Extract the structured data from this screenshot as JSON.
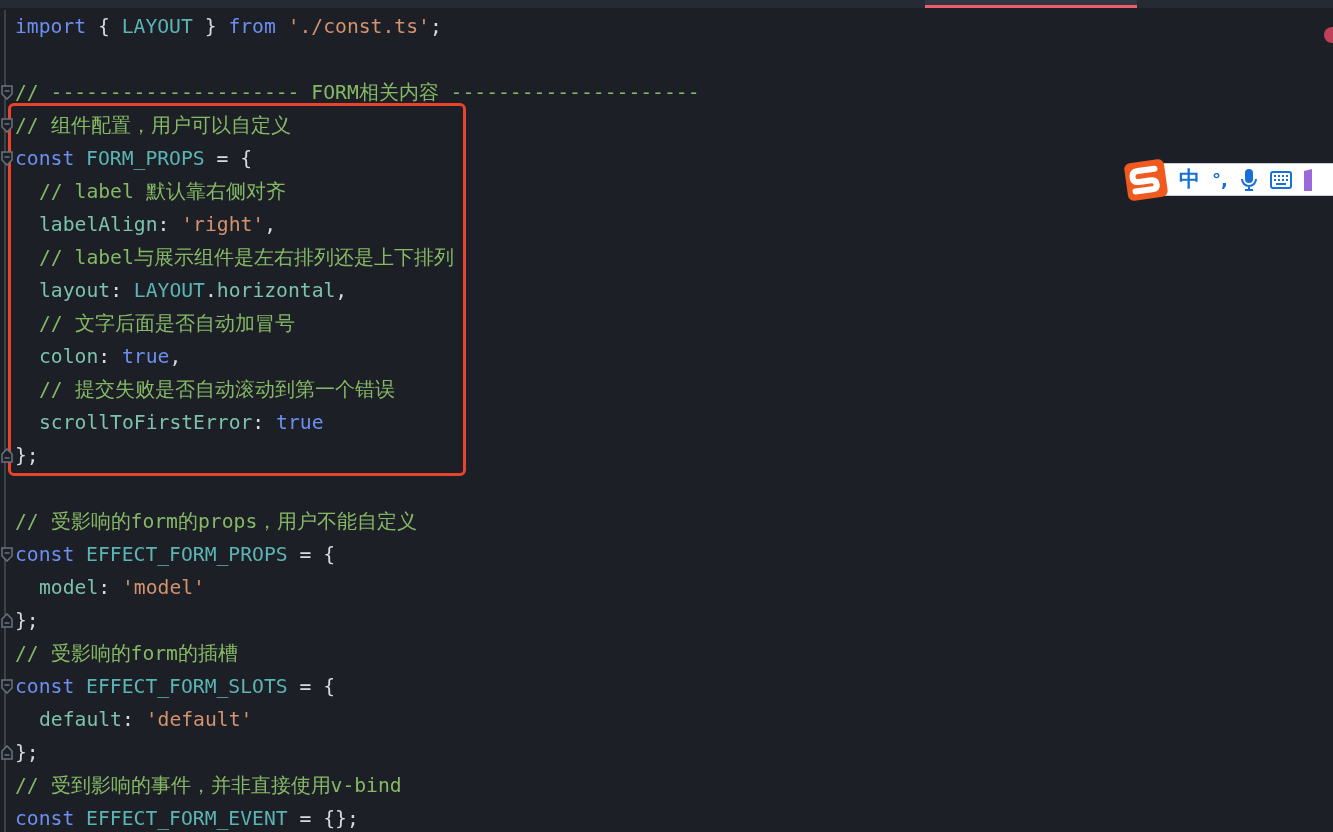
{
  "editor": {
    "lines": [
      {
        "kind": "code",
        "tokens": [
          {
            "kind": "kw",
            "text": "import"
          },
          {
            "kind": "punct",
            "text": " { "
          },
          {
            "kind": "ident",
            "text": "LAYOUT"
          },
          {
            "kind": "punct",
            "text": " } "
          },
          {
            "kind": "kw",
            "text": "from"
          },
          {
            "kind": "str",
            "text": " './const.ts'"
          },
          {
            "kind": "punct",
            "text": ";"
          }
        ]
      },
      {
        "kind": "blank"
      },
      {
        "kind": "code",
        "fold_start": true,
        "tokens": [
          {
            "kind": "comment",
            "text": "// --------------------- FORM相关内容 ---------------------"
          }
        ]
      },
      {
        "kind": "code",
        "fold_start": true,
        "boxed": true,
        "tokens": [
          {
            "kind": "comment",
            "text": "// 组件配置，用户可以自定义"
          }
        ]
      },
      {
        "kind": "code",
        "fold_start": true,
        "boxed": true,
        "tokens": [
          {
            "kind": "kw",
            "text": "const"
          },
          {
            "kind": "ident",
            "text": " FORM_PROPS"
          },
          {
            "kind": "punct",
            "text": " = {"
          }
        ]
      },
      {
        "kind": "code",
        "indent": true,
        "boxed": true,
        "tokens": [
          {
            "kind": "comment",
            "text": "// label 默认靠右侧对齐"
          }
        ]
      },
      {
        "kind": "code",
        "indent": true,
        "boxed": true,
        "tokens": [
          {
            "kind": "prop",
            "text": "labelAlign"
          },
          {
            "kind": "punct",
            "text": ": "
          },
          {
            "kind": "str",
            "text": "'right'"
          },
          {
            "kind": "punct",
            "text": ","
          }
        ]
      },
      {
        "kind": "code",
        "indent": true,
        "boxed": true,
        "tokens": [
          {
            "kind": "comment",
            "text": "// label与展示组件是左右排列还是上下排列"
          }
        ]
      },
      {
        "kind": "code",
        "indent": true,
        "boxed": true,
        "tokens": [
          {
            "kind": "prop",
            "text": "layout"
          },
          {
            "kind": "punct",
            "text": ": "
          },
          {
            "kind": "ident",
            "text": "LAYOUT"
          },
          {
            "kind": "punct",
            "text": "."
          },
          {
            "kind": "prop",
            "text": "horizontal"
          },
          {
            "kind": "punct",
            "text": ","
          }
        ]
      },
      {
        "kind": "code",
        "indent": true,
        "boxed": true,
        "tokens": [
          {
            "kind": "comment",
            "text": "// 文字后面是否自动加冒号"
          }
        ]
      },
      {
        "kind": "code",
        "indent": true,
        "boxed": true,
        "tokens": [
          {
            "kind": "prop",
            "text": "colon"
          },
          {
            "kind": "punct",
            "text": ": "
          },
          {
            "kind": "bool",
            "text": "true"
          },
          {
            "kind": "punct",
            "text": ","
          }
        ]
      },
      {
        "kind": "code",
        "indent": true,
        "boxed": true,
        "tokens": [
          {
            "kind": "comment",
            "text": "// 提交失败是否自动滚动到第一个错误"
          }
        ]
      },
      {
        "kind": "code",
        "indent": true,
        "boxed": true,
        "tokens": [
          {
            "kind": "prop",
            "text": "scrollToFirstError"
          },
          {
            "kind": "punct",
            "text": ": "
          },
          {
            "kind": "bool",
            "text": "true"
          }
        ]
      },
      {
        "kind": "code",
        "fold_end": true,
        "boxed": true,
        "tokens": [
          {
            "kind": "punct",
            "text": "};"
          }
        ]
      },
      {
        "kind": "blank"
      },
      {
        "kind": "code",
        "tokens": [
          {
            "kind": "comment",
            "text": "// 受影响的form的props，用户不能自定义"
          }
        ]
      },
      {
        "kind": "code",
        "fold_start": true,
        "tokens": [
          {
            "kind": "kw",
            "text": "const"
          },
          {
            "kind": "ident",
            "text": " EFFECT_FORM_PROPS"
          },
          {
            "kind": "punct",
            "text": " = {"
          }
        ]
      },
      {
        "kind": "code",
        "indent": true,
        "tokens": [
          {
            "kind": "prop",
            "text": "model"
          },
          {
            "kind": "punct",
            "text": ": "
          },
          {
            "kind": "str",
            "text": "'model'"
          }
        ]
      },
      {
        "kind": "code",
        "fold_end": true,
        "tokens": [
          {
            "kind": "punct",
            "text": "};"
          }
        ]
      },
      {
        "kind": "code",
        "tokens": [
          {
            "kind": "comment",
            "text": "// 受影响的form的插槽"
          }
        ]
      },
      {
        "kind": "code",
        "fold_start": true,
        "tokens": [
          {
            "kind": "kw",
            "text": "const"
          },
          {
            "kind": "ident",
            "text": " EFFECT_FORM_SLOTS"
          },
          {
            "kind": "punct",
            "text": " = {"
          }
        ]
      },
      {
        "kind": "code",
        "indent": true,
        "tokens": [
          {
            "kind": "prop",
            "text": "default"
          },
          {
            "kind": "punct",
            "text": ": "
          },
          {
            "kind": "str",
            "text": "'default'"
          }
        ]
      },
      {
        "kind": "code",
        "fold_end": true,
        "tokens": [
          {
            "kind": "punct",
            "text": "};"
          }
        ]
      },
      {
        "kind": "code",
        "tokens": [
          {
            "kind": "comment",
            "text": "// 受到影响的事件，并非直接使用v-bind"
          }
        ]
      },
      {
        "kind": "code",
        "tokens": [
          {
            "kind": "kw",
            "text": "const"
          },
          {
            "kind": "ident",
            "text": " EFFECT_FORM_EVENT"
          },
          {
            "kind": "punct",
            "text": " = {};"
          }
        ]
      }
    ]
  },
  "ime_toolbar": {
    "mode_label": "中",
    "punctuation_label": "°,"
  }
}
